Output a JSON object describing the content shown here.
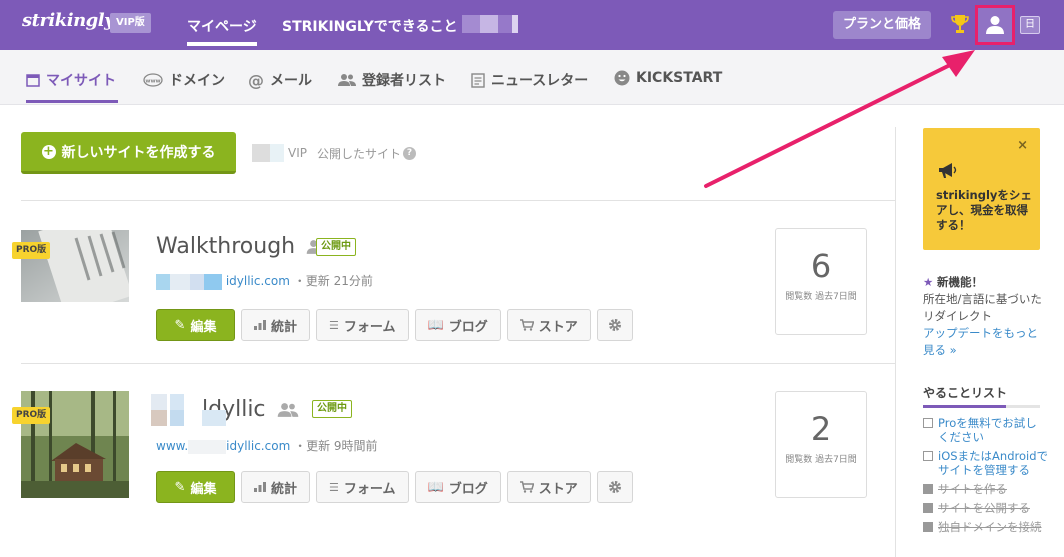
{
  "topbar": {
    "logo": "strikingly",
    "vip_badge": "VIP版",
    "nav_mypage": "マイページ",
    "nav_features": "STRIKINGLYでできること",
    "plan_button": "プランと価格",
    "lang_button": "日",
    "trophy_icon": "trophy-icon",
    "profile_icon": "user-icon",
    "profile_highlight_color": "#e8216b",
    "brand_color": "#7d5ab8"
  },
  "subnav": {
    "items": [
      {
        "label": "マイサイト",
        "icon": "window-icon"
      },
      {
        "label": "ドメイン",
        "icon": "www-icon"
      },
      {
        "label": "メール",
        "icon": "at-icon"
      },
      {
        "label": "登録者リスト",
        "icon": "users-icon"
      },
      {
        "label": "ニュースレター",
        "icon": "newsletter-icon"
      },
      {
        "label": "KICKSTART",
        "icon": "smile-icon"
      }
    ]
  },
  "main": {
    "new_site_button": "新しいサイトを作成する",
    "vip_label": "VIP",
    "published_sites_label": "公開したサイト",
    "sites": [
      {
        "name": "Walkthrough",
        "pro_badge": "PRO版",
        "live_badge": "公開中",
        "url_suffix": "idyllic.com",
        "updated": "・更新 21分前",
        "views": "6",
        "views_label": "閲覧数 過去7日間"
      },
      {
        "name": "ldyllic",
        "pro_badge": "PRO版",
        "live_badge": "公開中",
        "url_prefix": "www.",
        "url_suffix": "idyllic.com",
        "updated": "・更新 9時間前",
        "views": "2",
        "views_label": "閲覧数 過去7日間"
      }
    ],
    "buttons": {
      "edit": "編集",
      "stats": "統計",
      "form": "フォーム",
      "blog": "ブログ",
      "store": "ストア"
    }
  },
  "sidebar": {
    "promo_close": "×",
    "promo_text": "strikinglyをシェアし、現金を取得する！",
    "new_feature_title": "新機能！",
    "new_feature_text": "所在地/言語に基づいたリダイレクト",
    "new_feature_link": "アップデートをもっと見る »",
    "todo_title": "やることリスト",
    "todo_items": [
      {
        "label": "Proを無料でお試しください",
        "done": false
      },
      {
        "label": "iOSまたはAndroidでサイトを管理する",
        "done": false
      },
      {
        "label": "サイトを作る",
        "done": true
      },
      {
        "label": "サイトを公開する",
        "done": true
      },
      {
        "label": "独自ドメインを接続",
        "done": true
      }
    ]
  }
}
